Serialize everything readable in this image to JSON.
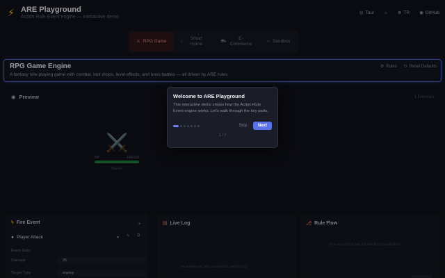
{
  "header": {
    "title": "ARE Playground",
    "subtitle": "Action Rule Event engine — interactive demo",
    "tour_label": "Tour",
    "lang_label": "TR",
    "github_label": "GitHub"
  },
  "tabs": [
    {
      "label": "RPG Game",
      "icon": "sword-icon",
      "active": true
    },
    {
      "label": "Smart Home",
      "icon": "home-icon",
      "active": false
    },
    {
      "label": "E-Commerce",
      "icon": "cart-icon",
      "active": false
    },
    {
      "label": "Sandbox",
      "icon": "code-icon",
      "active": false
    }
  ],
  "engine": {
    "title": "RPG Game Engine",
    "description": "A fantasy role-playing game with combat, loot drops, level effects, and boss battles — all driven by ARE rules.",
    "action1": "Rules",
    "action2": "Reset Defaults"
  },
  "preview": {
    "title": "Preview",
    "right_label": "1 Enemies",
    "hp_label": "HP",
    "hp_value": "100/100",
    "hp_fraction": 1.0,
    "sprite_label": "Warrior"
  },
  "modal": {
    "title": "Welcome to ARE Playground",
    "body": "This interactive demo shows how the Action Rule Event engine works. Let's walk through the key parts.",
    "skip_label": "Skip",
    "next_label": "Next",
    "step": "1 / 7",
    "total_steps": 7,
    "current_step": 1
  },
  "fire_event": {
    "title": "Fire Event",
    "selected_event": "Player Attack",
    "section_label": "Event Data",
    "fields": [
      {
        "label": "Damage",
        "value": "25"
      },
      {
        "label": "Target Type",
        "value": "enemy"
      }
    ]
  },
  "live_log": {
    "title": "Live Log",
    "empty_text": "No events yet. Fire an event to see the log."
  },
  "rule_flow": {
    "title": "Rule Flow",
    "empty_text": "Fire an event to see the rule flow visualization."
  },
  "colors": {
    "accent": "#5b72e6",
    "active_tab": "#e2776f",
    "logo": "#f0b429",
    "hp": "#1d7a3a"
  }
}
